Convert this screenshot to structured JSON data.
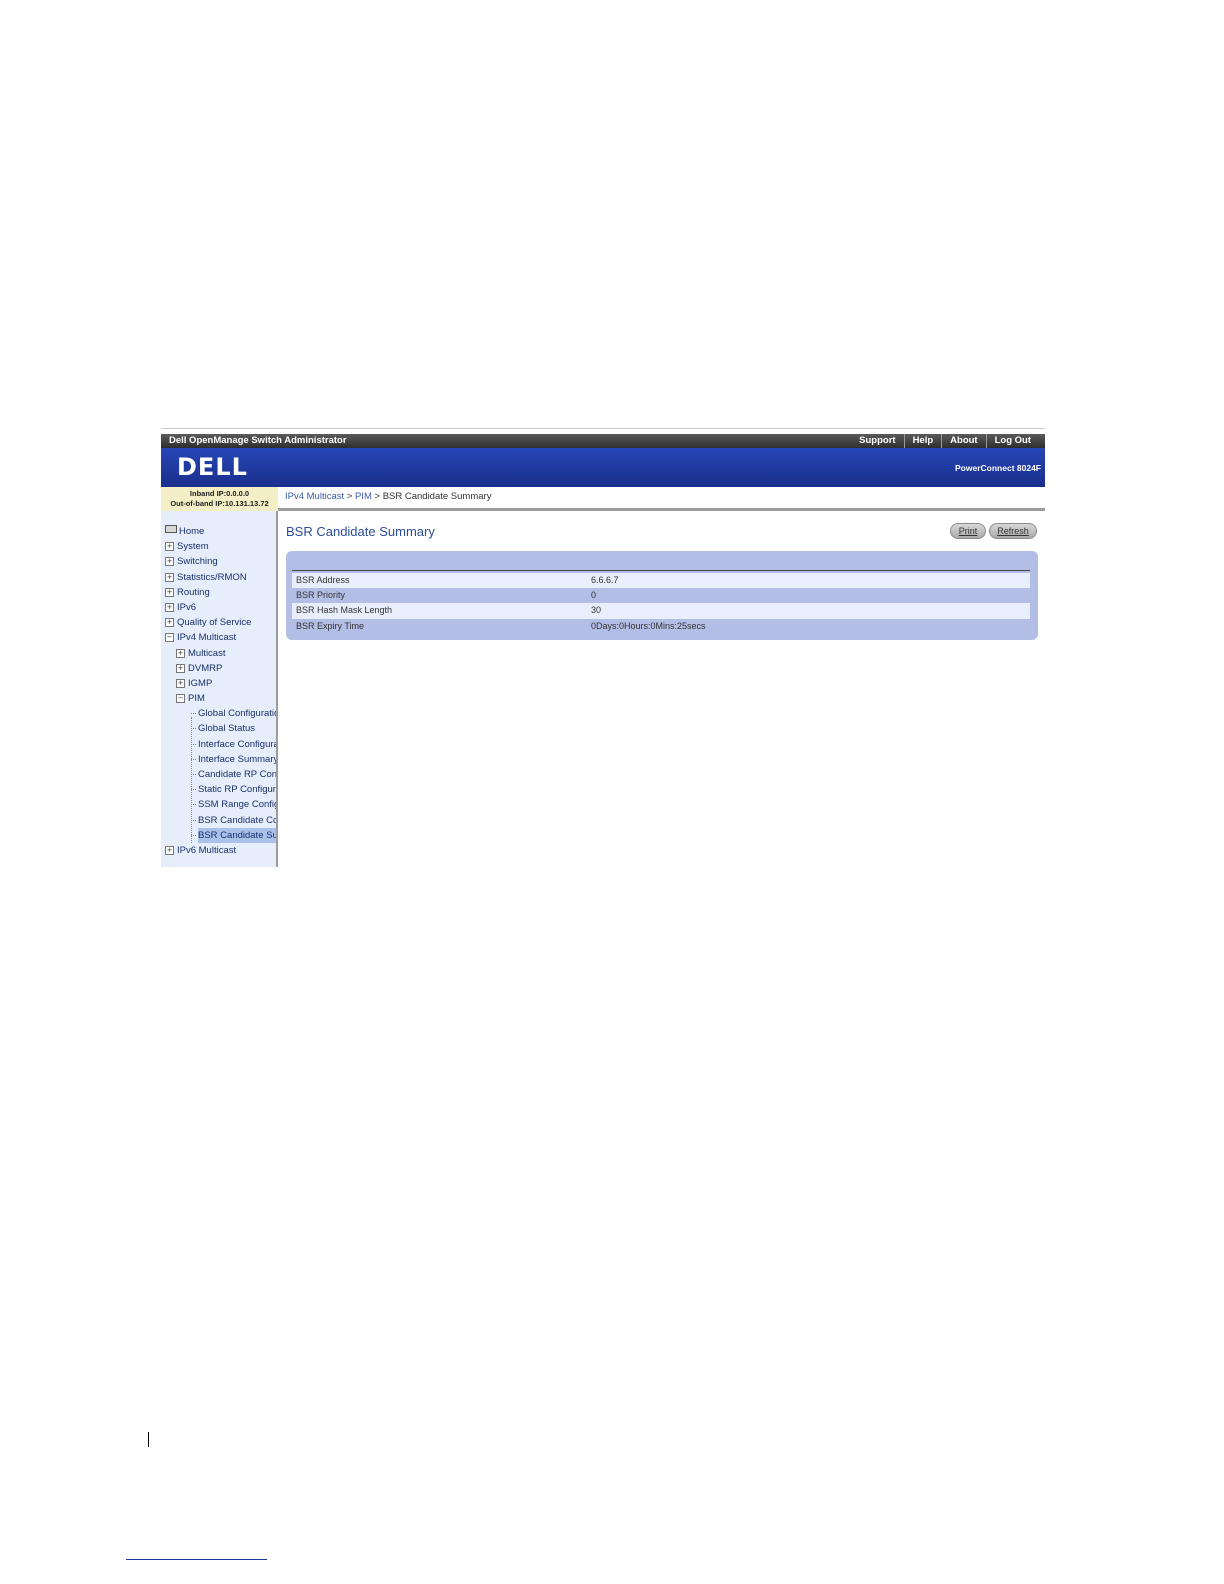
{
  "window": {
    "app_title": "Dell OpenManage Switch Administrator",
    "top_links": [
      "Support",
      "Help",
      "About",
      "Log Out"
    ],
    "logo": "DELL",
    "product": "PowerConnect 8024F"
  },
  "ip_info": {
    "inband": "Inband IP:0.0.0.0",
    "out_of_band": "Out-of-band IP:10.131.13.72"
  },
  "breadcrumb": {
    "part1": "IPv4 Multicast",
    "sep": " > ",
    "part2": "PIM",
    "current": "BSR Candidate Summary"
  },
  "nav": {
    "home": "Home",
    "system": "System",
    "switching": "Switching",
    "statistics": "Statistics/RMON",
    "routing": "Routing",
    "ipv6": "IPv6",
    "qos": "Quality of Service",
    "ipv4_multicast": "IPv4 Multicast",
    "multicast": "Multicast",
    "dvmrp": "DVMRP",
    "igmp": "IGMP",
    "pim": "PIM",
    "pim_children": [
      "Global Configuration",
      "Global Status",
      "Interface Configurati",
      "Interface Summary",
      "Candidate RP Confi",
      "Static RP Configura",
      "SSM Range Configu",
      "BSR Candidate Cor",
      "BSR Candidate Sur"
    ],
    "ipv6_multicast": "IPv6 Multicast"
  },
  "main": {
    "title": "BSR Candidate Summary",
    "print_label": "Print",
    "refresh_label": "Refresh",
    "rows": [
      {
        "label": "BSR Address",
        "value": "6.6.6.7"
      },
      {
        "label": "BSR Priority",
        "value": "0"
      },
      {
        "label": "BSR Hash Mask Length",
        "value": "30"
      },
      {
        "label": "BSR Expiry Time",
        "value": "0Days:0Hours:0Mins:25secs"
      }
    ]
  }
}
